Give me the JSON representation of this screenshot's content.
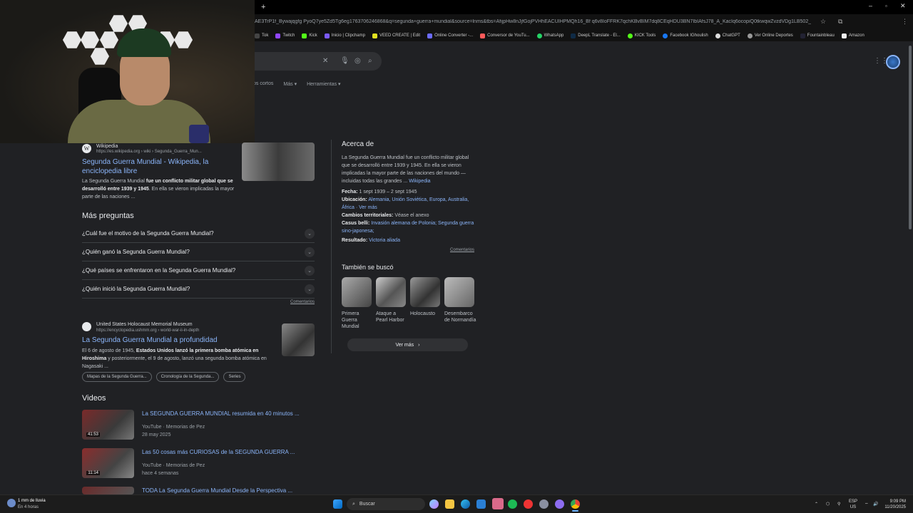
{
  "browser": {
    "url": "AE3TrP1f_Bywajqgfg PyoQ7ye5Zd5Tg6eg1763706246868&q=segunda+guerra+mundial&source=lnms&tbs=AfijpHw8nJjfGojPVHhEACUIHPMQh16_Bf q6v8IoFFRK7qchKBvBIM7dq8CEqHDU3BN7IbIAfsJ78_A_KacIq6ocopiQ0tkwqwZvzdVDg1LB502_hsUI1f...",
    "bookmarks": [
      "Tok",
      "Twitch",
      "Kick",
      "Inicio | Clipchamp",
      "VEED CREATE | Edit",
      "Online Converter -...",
      "Conversor de YouTu...",
      "WhatsApp",
      "DeepL Translate - El...",
      "KICK Tools",
      "Facebook IGhoulish",
      "ChatGPT",
      "Ver Online Deportes",
      "Fountainbleau",
      "Amazon"
    ]
  },
  "search": {
    "tabs": [
      "os cortos",
      "Más ▾",
      "Herramientas ▾"
    ]
  },
  "wiki_result": {
    "site": "Wikipedia",
    "url": "https://es.wikipedia.org › wiki › Segunda_Guerra_Mun...",
    "title": "Segunda Guerra Mundial - Wikipedia, la enciclopedia libre",
    "snippet_a": "La Segunda Guerra Mundial",
    "snippet_b": "fue un conflicto militar global que se desarrolló entre 1939 y 1945",
    "snippet_c": ". En ella se vieron implicadas la mayor parte de las naciones ..."
  },
  "faq": {
    "heading": "Más preguntas",
    "items": [
      "¿Cuál fue el motivo de la Segunda Guerra Mundial?",
      "¿Quién ganó la Segunda Guerra Mundial?",
      "¿Qué países se enfrentaron en la Segunda Guerra Mundial?",
      "¿Quién inició la Segunda Guerra Mundial?"
    ],
    "feedback": "Comentarios"
  },
  "holocaust_result": {
    "site": "United States Holocaust Memorial Museum",
    "url": "https://encyclopedia.ushmm.org › world-war-ii-in-depth",
    "title": "La Segunda Guerra Mundial a profundidad",
    "snippet_a": "El 6 de agosto de 1945,",
    "snippet_b": "Estados Unidos lanzó la primera bomba atómica en Hiroshima",
    "snippet_c": "y posteriormente, el 9 de agosto, lanzó una segunda bomba atómica en Nagasaki ...",
    "chips": [
      "Mapas de la Segunda Guerra...",
      "Cronología de la Segunda...",
      "Series"
    ]
  },
  "videos": {
    "heading": "Videos",
    "items": [
      {
        "title": "La SEGUNDA GUERRA MUNDIAL resumida en 40 minutos ...",
        "source": "YouTube · Memorias de Pez",
        "date": "28 may 2025",
        "duration": "41:53"
      },
      {
        "title": "Las 50 cosas más CURIOSAS de la SEGUNDA GUERRA ...",
        "source": "YouTube · Memorias de Pez",
        "date": "hace 4 semanas",
        "duration": "11:14"
      },
      {
        "title": "TODA La Segunda Guerra Mundial Desde la Perspectiva ...",
        "source": "",
        "date": "",
        "duration": ""
      }
    ]
  },
  "knowledge_panel": {
    "heading": "Acerca de",
    "description": "La Segunda Guerra Mundial fue un conflicto militar global que se desarrolló entre 1939 y 1945. En ella se vieron implicadas la mayor parte de las naciones del mundo —incluidas todas las grandes ...",
    "wiki_link": "Wikipedia",
    "facts": [
      {
        "label": "Fecha:",
        "value": "1 sept 1939 – 2 sept 1945",
        "is_link": false
      },
      {
        "label": "Ubicación:",
        "value": "Alemania, Unión Soviética, Europa, Australia, África · Ver más",
        "is_link": true
      },
      {
        "label": "Cambios territoriales:",
        "value": "Véase el anexo",
        "is_link": false
      },
      {
        "label": "Casus belli:",
        "value": "Invasión alemana de Polonia; Segunda guerra sino-japonesa;",
        "is_link": true
      },
      {
        "label": "Resultado:",
        "value": "Victoria aliada",
        "is_link": true
      }
    ],
    "feedback": "Comentarios",
    "also_searched_heading": "También se buscó",
    "also_searched": [
      "Primera Guerra Mundial",
      "Ataque a Pearl Harbor",
      "Holocausto",
      "Desembarco de Normandía"
    ],
    "see_more": "Ver más"
  },
  "taskbar": {
    "weather_title": "1 mm de lluvia",
    "weather_sub": "En 4 horas",
    "search_label": "Buscar",
    "lang_top": "ESP",
    "lang_bottom": "US",
    "time": "9:09 PM",
    "date": "11/20/2025"
  },
  "colors": {
    "background": "#202124",
    "link": "#8ab4f8",
    "text": "#bdc1c6"
  }
}
